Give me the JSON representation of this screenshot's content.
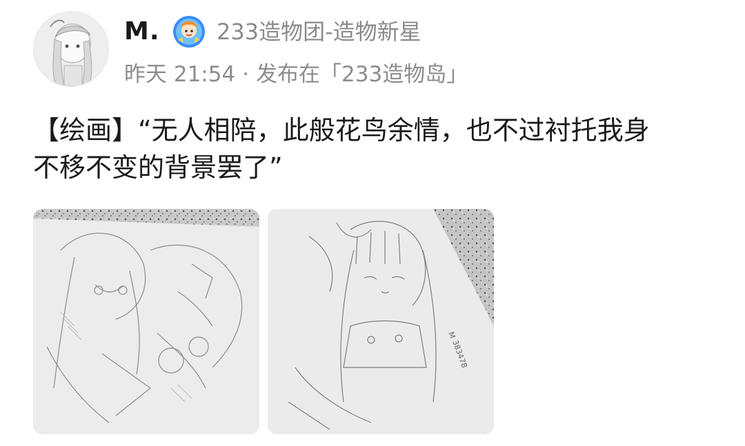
{
  "post": {
    "author": {
      "name": "M.",
      "avatar_icon": "anime-character-avatar",
      "badge_icon": "creator-badge-icon",
      "badge_title": "233造物团-造物新星"
    },
    "meta": {
      "time": "昨天 21:54",
      "separator": "·",
      "posted_in": "发布在「233造物岛」"
    },
    "content": {
      "line1": "【绘画】“无人相陪，此般花鸟余情，也不过衬托我身",
      "line2": "不移不变的背景罢了”"
    },
    "images": [
      {
        "icon": "pencil-sketch-photo"
      },
      {
        "icon": "pencil-sketch-photo"
      }
    ]
  }
}
